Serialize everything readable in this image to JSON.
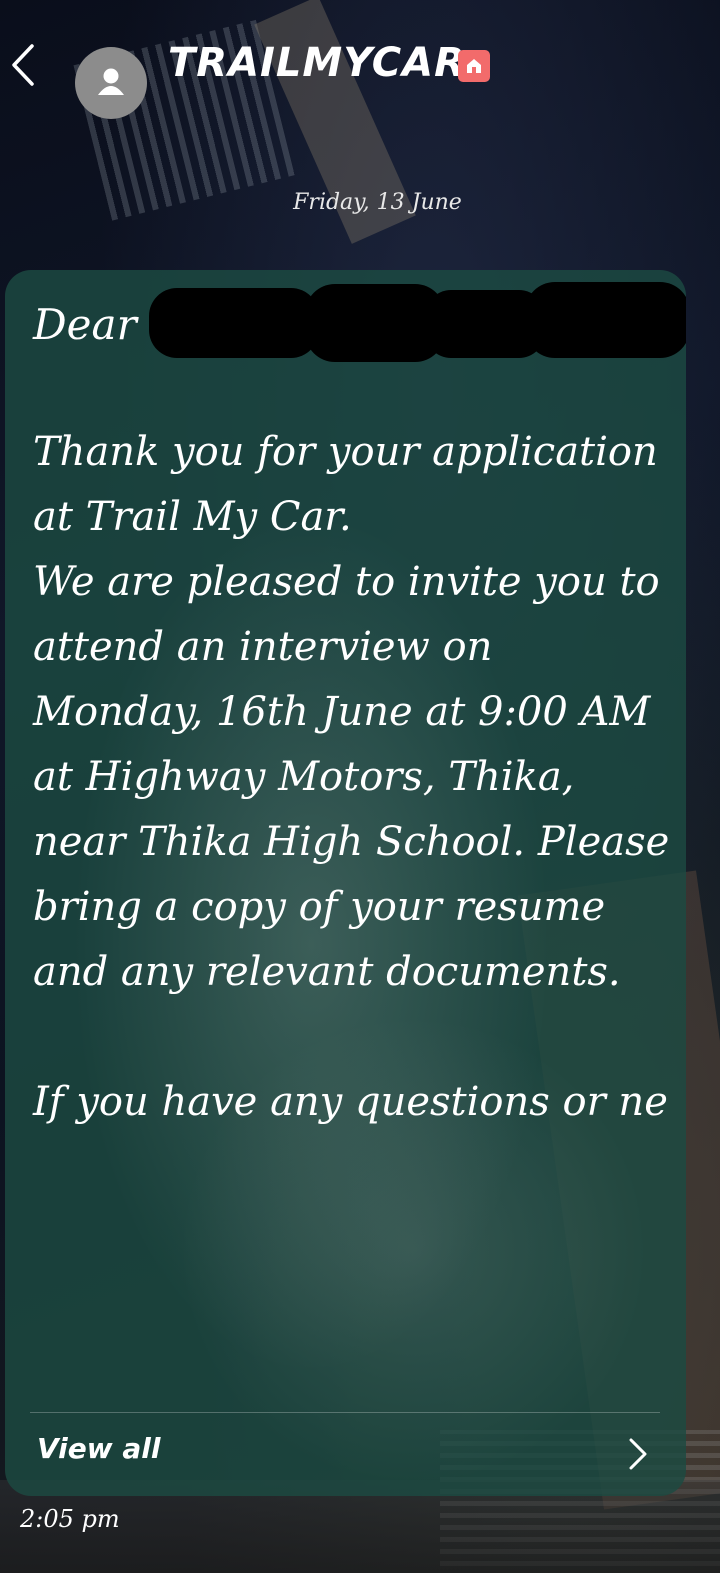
{
  "header": {
    "contact_name": "TRAILMYCAR",
    "back_icon": "chevron-left-icon",
    "avatar_icon": "person-icon",
    "badge_icon": "home-icon",
    "badge_color": "#f26b6b"
  },
  "date_label": "Friday, 13 June",
  "message": {
    "greeting": "Dear",
    "body": "Thank you for your application at Trail My Car.\nWe are pleased to invite you to attend an interview on Monday, 16th June at 9:00 AM at Highway Motors, Thika, near Thika High School. Please bring a copy of your resume and any relevant documents.\n\nIf you have any questions or ne",
    "view_all_label": "View all",
    "bubble_color": "#1c4a42",
    "timestamp": "2:05 pm"
  }
}
